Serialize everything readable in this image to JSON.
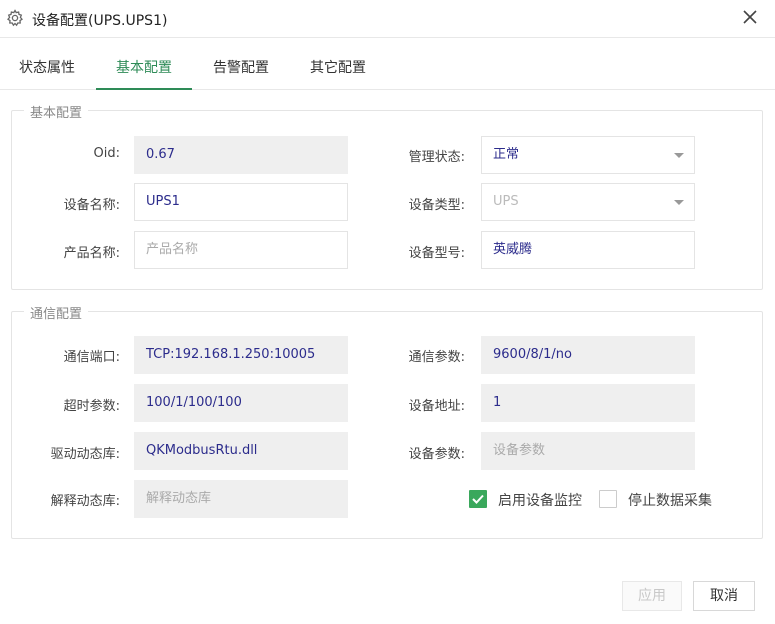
{
  "dialog": {
    "title": "设备配置(UPS.UPS1)",
    "icons": {
      "title": "gear-icon",
      "close": "close-icon"
    }
  },
  "tabs": [
    {
      "label": "状态属性",
      "active": false
    },
    {
      "label": "基本配置",
      "active": true
    },
    {
      "label": "告警配置",
      "active": false
    },
    {
      "label": "其它配置",
      "active": false
    }
  ],
  "basic": {
    "legend": "基本配置",
    "oid": {
      "label": "Oid:",
      "value": "0.67"
    },
    "mgmt_state": {
      "label": "管理状态:",
      "value": "正常"
    },
    "device_name": {
      "label": "设备名称:",
      "value": "UPS1"
    },
    "device_type": {
      "label": "设备类型:",
      "value": "UPS"
    },
    "product_name": {
      "label": "产品名称:",
      "placeholder": "产品名称"
    },
    "device_model": {
      "label": "设备型号:",
      "value": "英威腾"
    }
  },
  "comm": {
    "legend": "通信配置",
    "port": {
      "label": "通信端口:",
      "value": "TCP:192.168.1.250:10005"
    },
    "params": {
      "label": "通信参数:",
      "value": "9600/8/1/no"
    },
    "timeout": {
      "label": "超时参数:",
      "value": "100/1/100/100"
    },
    "address": {
      "label": "设备地址:",
      "value": "1"
    },
    "driver": {
      "label": "驱动动态库:",
      "value": "QKModbusRtu.dll"
    },
    "dev_params": {
      "label": "设备参数:",
      "placeholder": "设备参数"
    },
    "parser": {
      "label": "解释动态库:",
      "placeholder": "解释动态库"
    },
    "enable_monitor": {
      "label": "启用设备监控",
      "checked": true
    },
    "stop_collect": {
      "label": "停止数据采集",
      "checked": false
    }
  },
  "footer": {
    "apply": "应用",
    "cancel": "取消"
  },
  "colors": {
    "accent": "#2e8b57",
    "check": "#3aa85c",
    "value_text": "#2c2c8c"
  }
}
